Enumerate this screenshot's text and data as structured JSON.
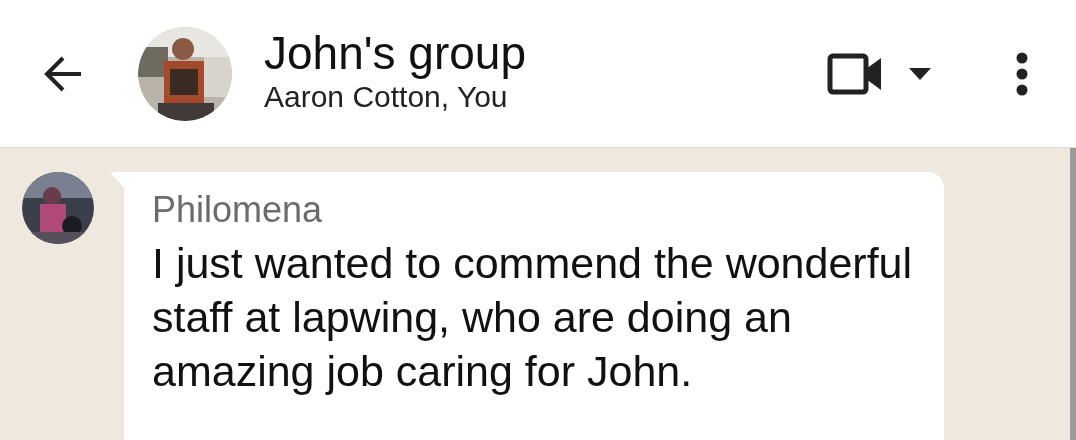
{
  "header": {
    "title": "John's group",
    "subtitle": "Aaron Cotton, You"
  },
  "messages": [
    {
      "sender": "Philomena",
      "text": "I just wanted to commend the wonderful staff at lapwing, who are doing an amazing job caring for John."
    }
  ]
}
